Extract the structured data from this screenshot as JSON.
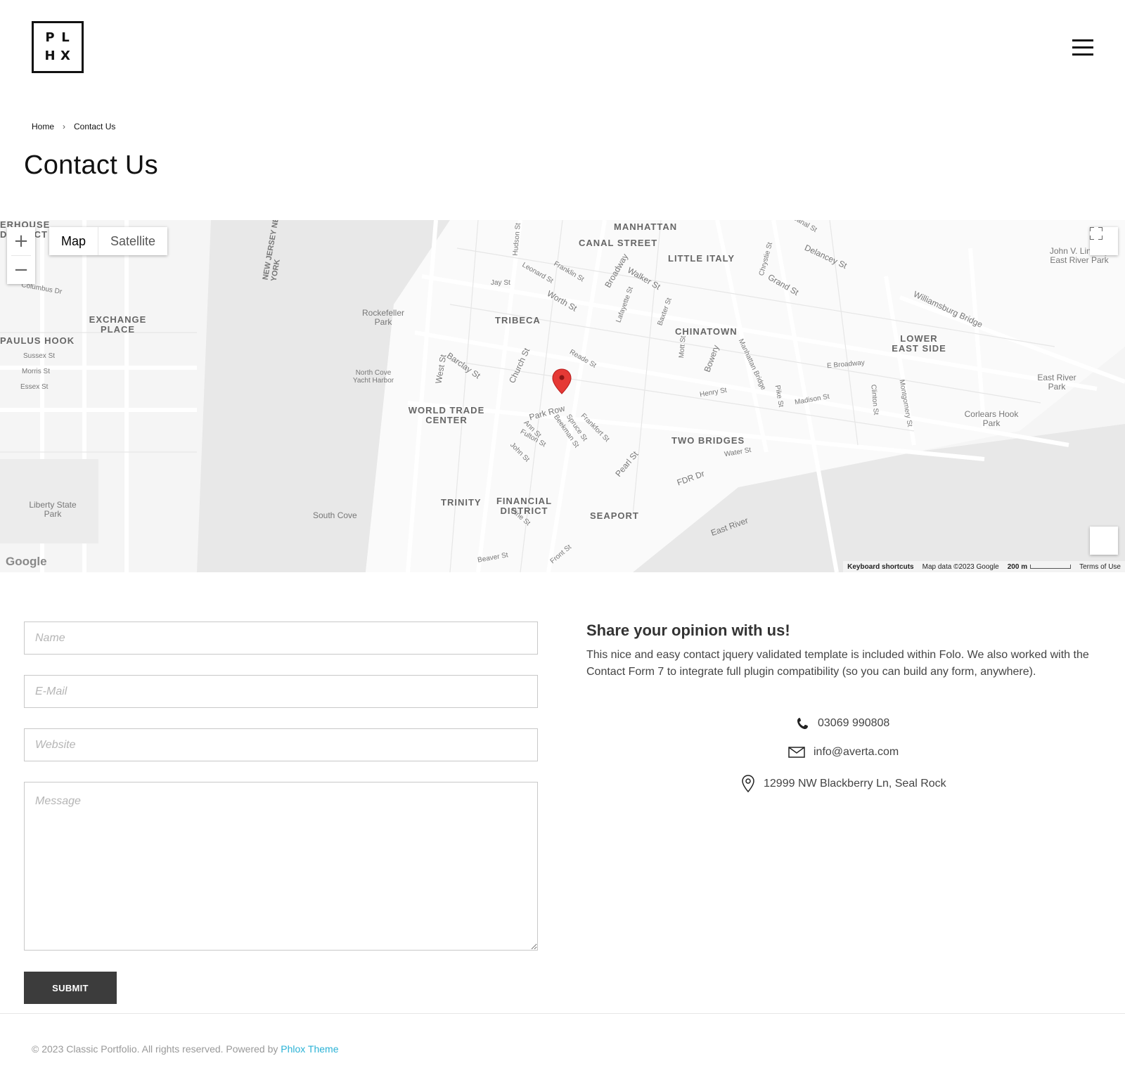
{
  "header": {
    "logo_letters": [
      "P",
      "L",
      "H",
      "X"
    ]
  },
  "breadcrumb": {
    "home": "Home",
    "current": "Contact Us"
  },
  "page_title": "Contact Us",
  "map": {
    "zoom_in": "+",
    "zoom_out": "−",
    "map_type": {
      "map": "Map",
      "satellite": "Satellite",
      "selected": "Map"
    },
    "google_logo": "Google",
    "footer": {
      "keyboard_shortcuts": "Keyboard shortcuts",
      "map_data": "Map data ©2023 Google",
      "scale": "200 m",
      "terms": "Terms of Use"
    },
    "neighborhoods": [
      "MANHATTAN",
      "CANAL STREET",
      "LITTLE ITALY",
      "TRIBECA",
      "CHINATOWN",
      "LOWER EAST SIDE",
      "WORLD TRADE CENTER",
      "TWO BRIDGES",
      "TRINITY",
      "FINANCIAL DISTRICT",
      "SEAPORT",
      "EXCHANGE PLACE",
      "PAULUS HOOK",
      "ERHOUSE DISTRICT"
    ],
    "parks": [
      "Rockefeller Park",
      "John V. Lindsay East River Park",
      "East River Park",
      "Corlears Hook Park",
      "Liberty State Park",
      "North Cove Yacht Harbor",
      "South Cove"
    ],
    "streets": [
      "Park Row",
      "West St",
      "Barclay St",
      "Church St",
      "Broadway",
      "Worth St",
      "Reade St",
      "Hudson St",
      "Canal St",
      "Walker St",
      "Grand St",
      "Delancey St",
      "Williamsburg Bridge",
      "Manhattan Bridge",
      "FDR Dr",
      "East River",
      "Pike St",
      "Madison St",
      "Henry St",
      "Water St",
      "Pearl St",
      "Fulton St",
      "Frankfort St",
      "Spruce St",
      "Beekman St",
      "Ann St",
      "John St",
      "Pine St",
      "Beaver St",
      "Front St",
      "Bowery",
      "Chrystie St",
      "Lafayette St",
      "Baxter St",
      "Mott St",
      "Clinton St",
      "Montgomery St",
      "E Broadway",
      "Jay St",
      "Leonard St",
      "Franklin St",
      "Columbus Dr",
      "Sussex St",
      "Morris St",
      "Essex St",
      "NEW JERSEY NEW YORK"
    ]
  },
  "form": {
    "name_placeholder": "Name",
    "email_placeholder": "E-Mail",
    "website_placeholder": "Website",
    "message_placeholder": "Message",
    "submit_label": "SUBMIT"
  },
  "info": {
    "title": "Share your opinion with us!",
    "text": "This nice and easy contact jquery validated template is included within Folo. We also worked with the Contact Form 7 to integrate full plugin compatibility (so you can build any form, anywhere).",
    "phone": "03069 990808",
    "email": "info@averta.com",
    "address": "12999 NW Blackberry Ln, Seal Rock"
  },
  "footer": {
    "copyright": "© 2023 Classic Portfolio. All rights reserved. Powered by ",
    "link_text": "Phlox Theme"
  },
  "colors": {
    "accent_link": "#2ab2d6",
    "button_bg": "#3c3c3c",
    "map_pin": "#e53935"
  }
}
